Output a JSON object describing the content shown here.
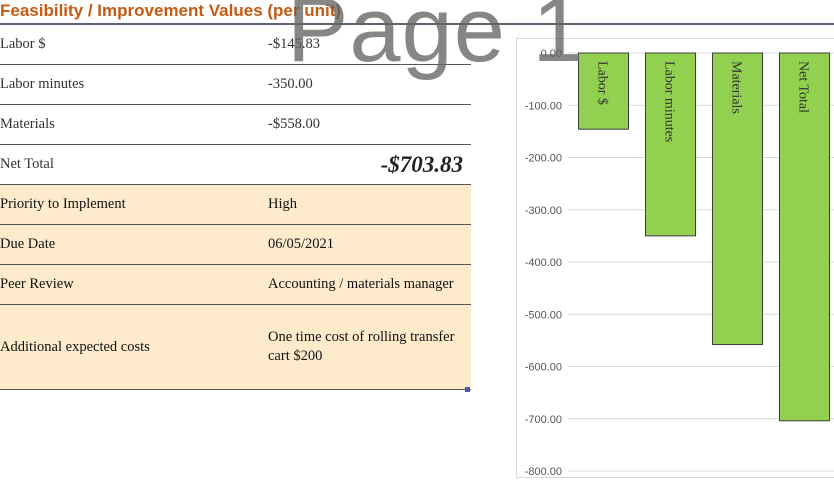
{
  "header": {
    "title": "Feasibility / Improvement Values (per unit)",
    "watermark": "Page 1"
  },
  "table": {
    "rows": [
      {
        "label": "Labor $",
        "value": "-$145.83"
      },
      {
        "label": "Labor minutes",
        "value": "-350.00"
      },
      {
        "label": "Materials",
        "value": "-$558.00"
      },
      {
        "label": "Net Total",
        "value": "-$703.83"
      },
      {
        "label": "Priority to Implement",
        "value": "High"
      },
      {
        "label": "Due Date",
        "value": "06/05/2021"
      },
      {
        "label": "Peer Review",
        "value": "Accounting / materials manager"
      },
      {
        "label": "Additional expected costs",
        "value": "One time cost of rolling transfer cart $200"
      }
    ]
  },
  "colors": {
    "title": "#c55a11",
    "highlight_fill": "#fdebcb",
    "bar_fill": "#92d050",
    "bar_stroke": "#3d3d3d"
  },
  "chart_data": {
    "type": "bar",
    "categories": [
      "Labor $",
      "Labor minutes",
      "Materials",
      "Net Total"
    ],
    "values": [
      -145.83,
      -350.0,
      -558.0,
      -703.83
    ],
    "ylim": [
      -800,
      0
    ],
    "yticks": [
      "0.00",
      "-100.00",
      "-200.00",
      "-300.00",
      "-400.00",
      "-500.00",
      "-600.00",
      "-700.00",
      "-800.00"
    ],
    "grid": true,
    "category_labels_rotated": true
  }
}
